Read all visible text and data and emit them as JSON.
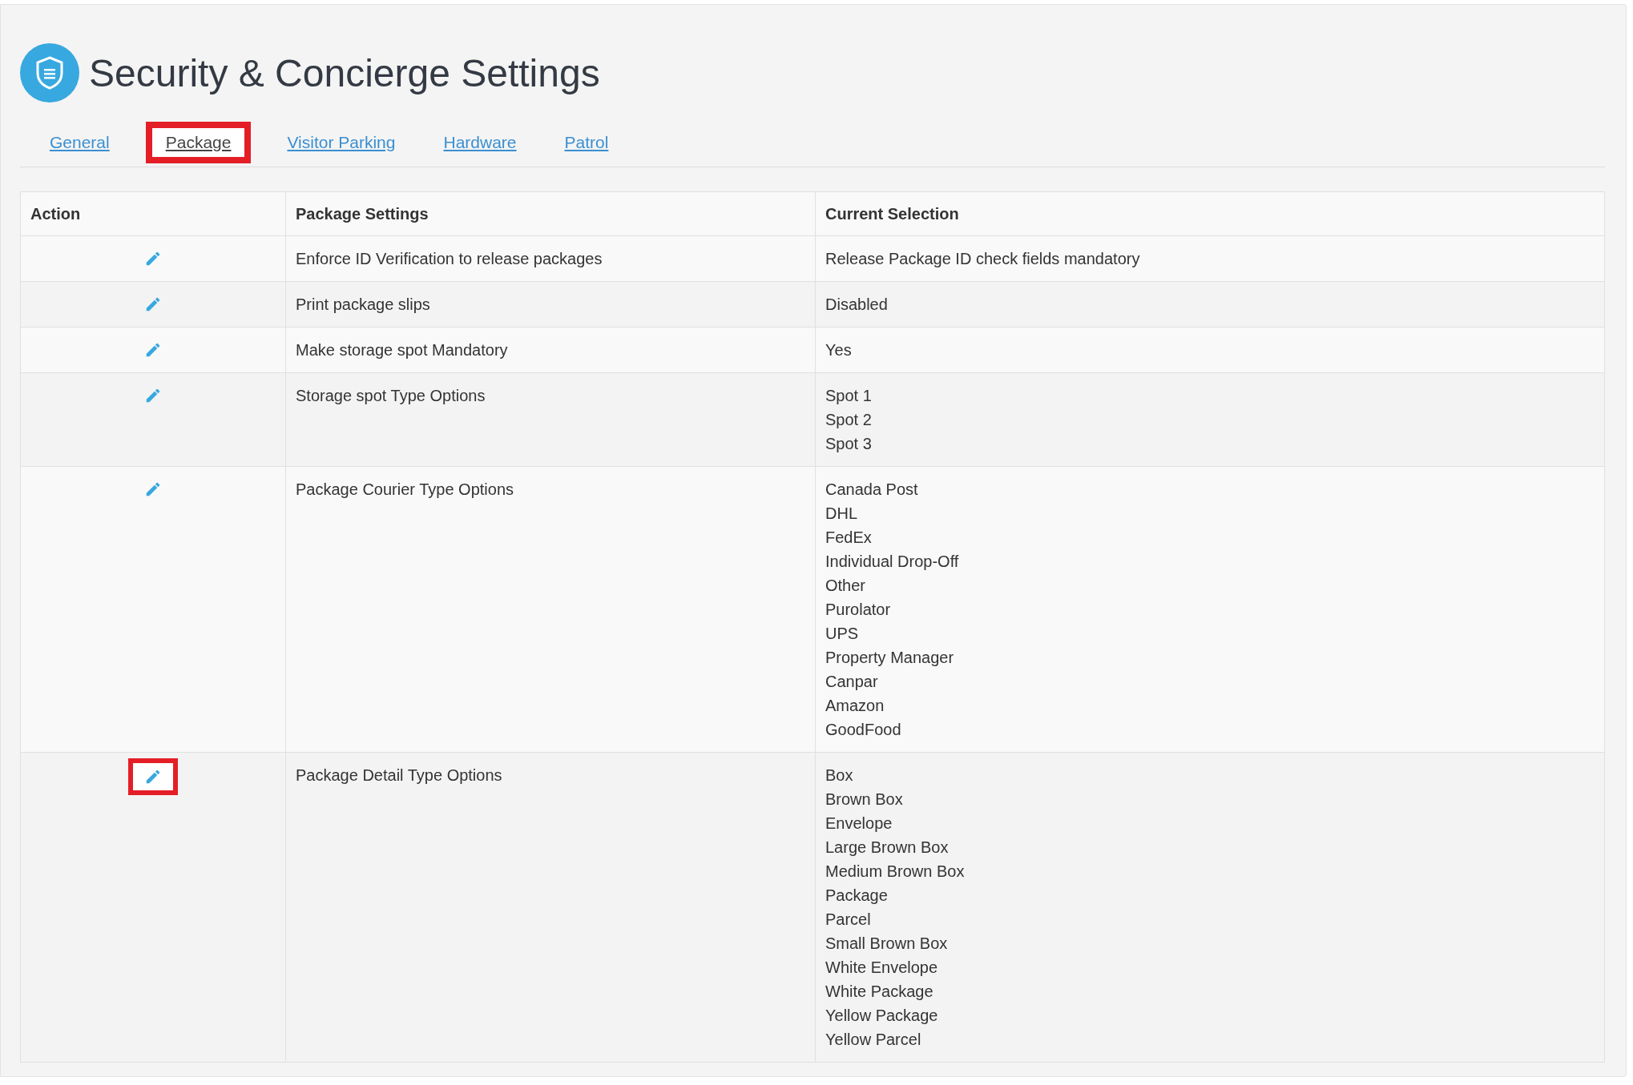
{
  "page": {
    "title": "Security & Concierge Settings"
  },
  "tabs": [
    {
      "label": "General",
      "selected": false,
      "highlighted": false
    },
    {
      "label": "Package",
      "selected": true,
      "highlighted": true
    },
    {
      "label": "Visitor Parking",
      "selected": false,
      "highlighted": false
    },
    {
      "label": "Hardware",
      "selected": false,
      "highlighted": false
    },
    {
      "label": "Patrol",
      "selected": false,
      "highlighted": false
    }
  ],
  "table": {
    "columns": [
      "Action",
      "Package Settings",
      "Current Selection"
    ],
    "rows": [
      {
        "setting": "Enforce ID Verification to release packages",
        "selection": [
          "Release Package ID check fields mandatory"
        ],
        "highlighted": false
      },
      {
        "setting": "Print package slips",
        "selection": [
          "Disabled"
        ],
        "highlighted": false
      },
      {
        "setting": "Make storage spot Mandatory",
        "selection": [
          "Yes"
        ],
        "highlighted": false
      },
      {
        "setting": "Storage spot Type Options",
        "selection": [
          "Spot 1",
          "Spot 2",
          "Spot 3"
        ],
        "highlighted": false
      },
      {
        "setting": "Package Courier Type Options",
        "selection": [
          "Canada Post",
          "DHL",
          "FedEx",
          "Individual Drop-Off",
          "Other",
          "Purolator",
          "UPS",
          "Property Manager",
          "Canpar",
          "Amazon",
          "GoodFood"
        ],
        "highlighted": false
      },
      {
        "setting": "Package Detail Type Options",
        "selection": [
          "Box",
          "Brown Box",
          "Envelope",
          "Large Brown Box",
          "Medium Brown Box",
          "Package",
          "Parcel",
          "Small Brown Box",
          "White Envelope",
          "White Package",
          "Yellow Package",
          "Yellow Parcel"
        ],
        "highlighted": true
      }
    ]
  }
}
